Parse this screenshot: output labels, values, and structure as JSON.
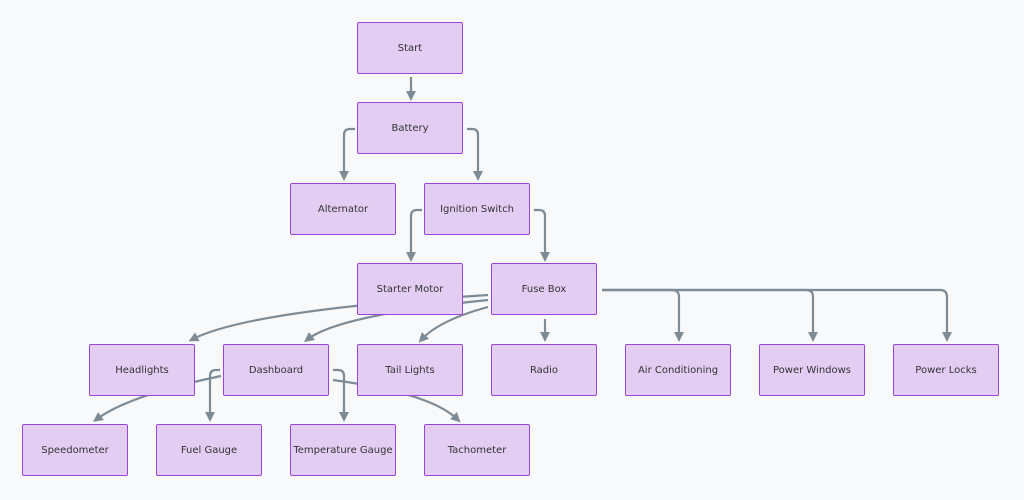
{
  "colors": {
    "node_fill": "#e4cdf3",
    "node_border": "#9b45d8",
    "edge": "#7d8b96",
    "background": "#f8f9fa"
  },
  "nodes": {
    "start": "Start",
    "battery": "Battery",
    "alternator": "Alternator",
    "ignition": "Ignition Switch",
    "starter": "Starter Motor",
    "fuse": "Fuse Box",
    "headlights": "Headlights",
    "dashboard": "Dashboard",
    "tail": "Tail Lights",
    "radio": "Radio",
    "ac": "Air Conditioning",
    "windows": "Power Windows",
    "locks": "Power Locks",
    "speedometer": "Speedometer",
    "fuel": "Fuel Gauge",
    "temp": "Temperature Gauge",
    "tacho": "Tachometer"
  },
  "edges": [
    [
      "Start",
      "Battery"
    ],
    [
      "Battery",
      "Alternator"
    ],
    [
      "Battery",
      "Ignition Switch"
    ],
    [
      "Ignition Switch",
      "Starter Motor"
    ],
    [
      "Ignition Switch",
      "Fuse Box"
    ],
    [
      "Fuse Box",
      "Headlights"
    ],
    [
      "Fuse Box",
      "Dashboard"
    ],
    [
      "Fuse Box",
      "Tail Lights"
    ],
    [
      "Fuse Box",
      "Radio"
    ],
    [
      "Fuse Box",
      "Air Conditioning"
    ],
    [
      "Fuse Box",
      "Power Windows"
    ],
    [
      "Fuse Box",
      "Power Locks"
    ],
    [
      "Dashboard",
      "Speedometer"
    ],
    [
      "Dashboard",
      "Fuel Gauge"
    ],
    [
      "Dashboard",
      "Temperature Gauge"
    ],
    [
      "Dashboard",
      "Tachometer"
    ]
  ]
}
